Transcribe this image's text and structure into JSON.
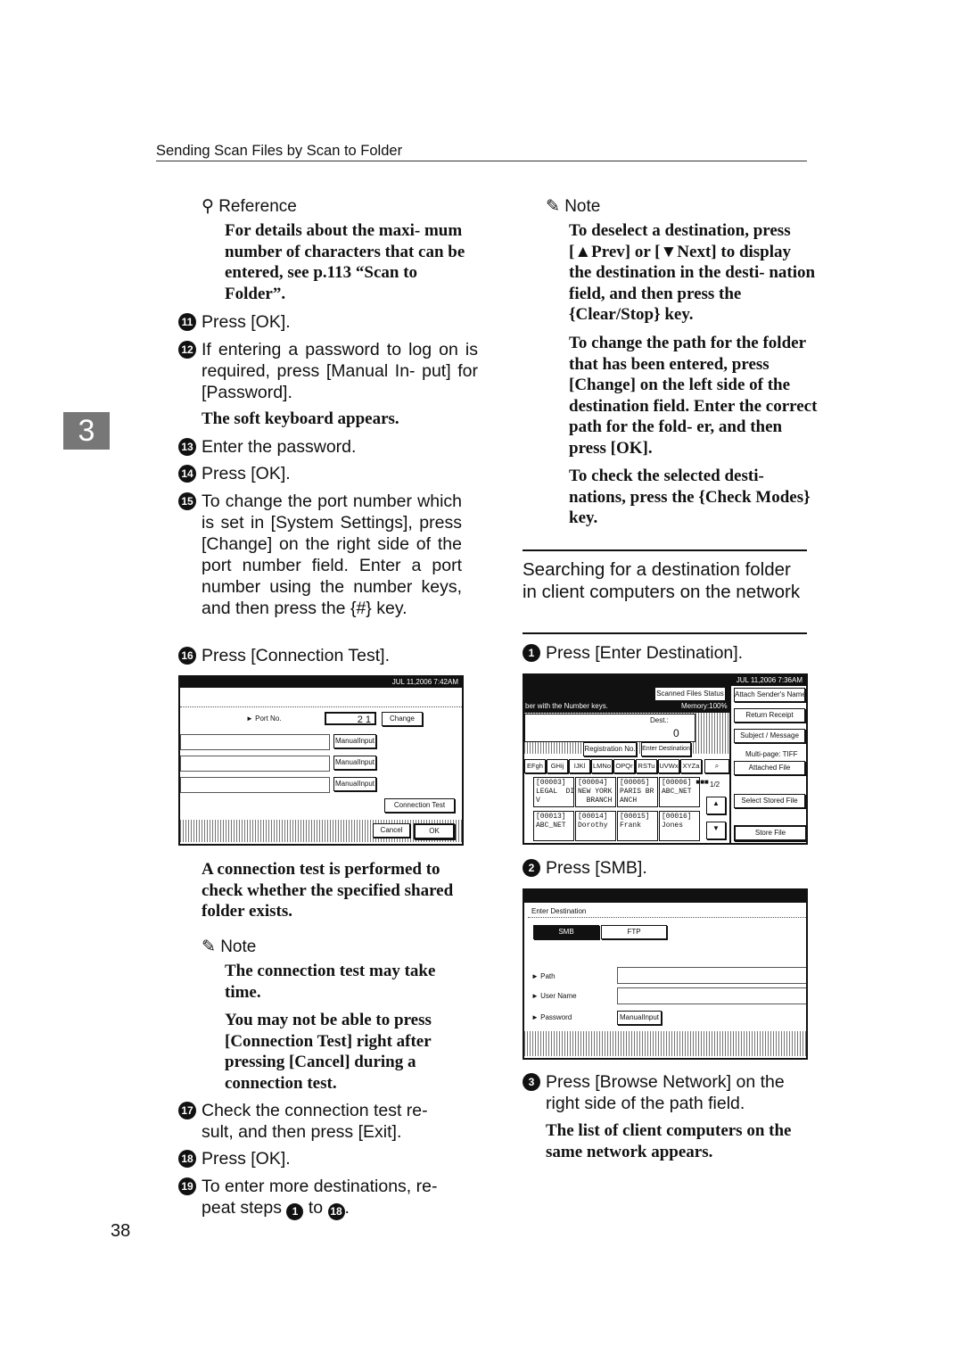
{
  "header": {
    "running_title": "Sending Scan Files by Scan to Folder"
  },
  "chapter_tab": "3",
  "page_number": "38",
  "left": {
    "reference": {
      "heading": "Reference",
      "body": "For details about the maxi- mum number of characters that can be entered, see p.113 “Scan to Folder”."
    },
    "steps": [
      {
        "n": "11",
        "text": "Press [OK]."
      },
      {
        "n": "12",
        "text": "If entering a password to log on is required, press [Manual In- put] for [Password]."
      },
      {
        "n": "13",
        "text": "Enter the password."
      },
      {
        "n": "14",
        "text": "Press [OK]."
      },
      {
        "n": "15",
        "text": "To change the port number which is set in [System Settings], press [Change] on the right side of the port number field. Enter a port number using the number keys, and then press the {#} key."
      },
      {
        "n": "16",
        "text": "Press [Connection Test]."
      },
      {
        "n": "17",
        "text": "Check the connection test re- sult, and then press [Exit]."
      },
      {
        "n": "18",
        "text": "Press [OK]."
      },
      {
        "n": "19",
        "text": "To enter more destinations, re- peat steps"
      }
    ],
    "step12_result": "The soft keyboard appears.",
    "step16_result": "A connection test is performed to check whether the specified shared folder exists.",
    "note": {
      "heading": "Note",
      "items": [
        "The connection test may take time.",
        "You may not be able to press [Connection Test] right after pressing [Cancel] during a connection test."
      ]
    },
    "step19_from": "1",
    "step19_to_word": "to",
    "step19_to": "18",
    "screen1": {
      "datetime": "JUL  11,2006  7:42AM",
      "port_label": "► Port No.",
      "port_value": "2 1",
      "change": "Change",
      "manual_input": "ManualInput",
      "connection_test": "Connection Test",
      "cancel": "Cancel",
      "ok": "OK"
    }
  },
  "right": {
    "note": {
      "heading": "Note",
      "items": [
        "To deselect a destination, press [▲Prev] or [▼Next] to display the destination in the desti- nation field, and then press the {Clear/Stop} key.",
        "To change the path for the folder that has been entered, press [Change] on the left side of the destination field. Enter the correct path for the fold- er, and then press [OK].",
        "To check the selected desti- nations, press the {Check Modes} key."
      ]
    },
    "section_title": "Searching for a destination folder in client computers on the network",
    "steps": [
      {
        "n": "1",
        "text": "Press [Enter Destination]."
      },
      {
        "n": "2",
        "text": "Press [SMB]."
      },
      {
        "n": "3",
        "text": "Press [Browse Network] on the right side of the path field."
      }
    ],
    "step3_result": "The list of client computers on the same network appears.",
    "screen2": {
      "datetime": "JUL  11,2006  7:36AM",
      "scanned_status": "Scanned Files Status",
      "instruction": "ber with the Number keys.",
      "memory": "Memory:100%",
      "dest_label": "Dest.:",
      "dest_count": "0",
      "registration_no": "Registration No.",
      "enter_destination": "Enter Destination",
      "tabs": [
        "EFgh",
        "GHij",
        "IJKl",
        "LMNo",
        "OPQr",
        "RSTu",
        "UVWx",
        "XYZa"
      ],
      "cells": [
        [
          "[00003]\nLEGAL  DI\nV",
          "[00004]\nNEW YORK\n  BRANCH",
          "[00005]\nPARIS BR\nANCH",
          "[00006] ■■■\nABC_NET"
        ],
        [
          "[00013]\nABC_NET",
          "[00014]\nDorothy",
          "[00015]\nFrank",
          "[00016]\nJones"
        ]
      ],
      "page": "1/2",
      "side": [
        "Attach Sender's Name",
        "Return Receipt",
        "Subject / Message"
      ],
      "multipage": "Multi-page: TIFF",
      "attached_file": "Attached File",
      "select_stored": "Select Stored File",
      "store_file": "Store File"
    },
    "screen3": {
      "title": "Enter Destination",
      "smb": "SMB",
      "ftp": "FTP",
      "path": "► Path",
      "user_name": "► User Name",
      "password": "► Password",
      "manual_input": "ManualInput"
    }
  }
}
